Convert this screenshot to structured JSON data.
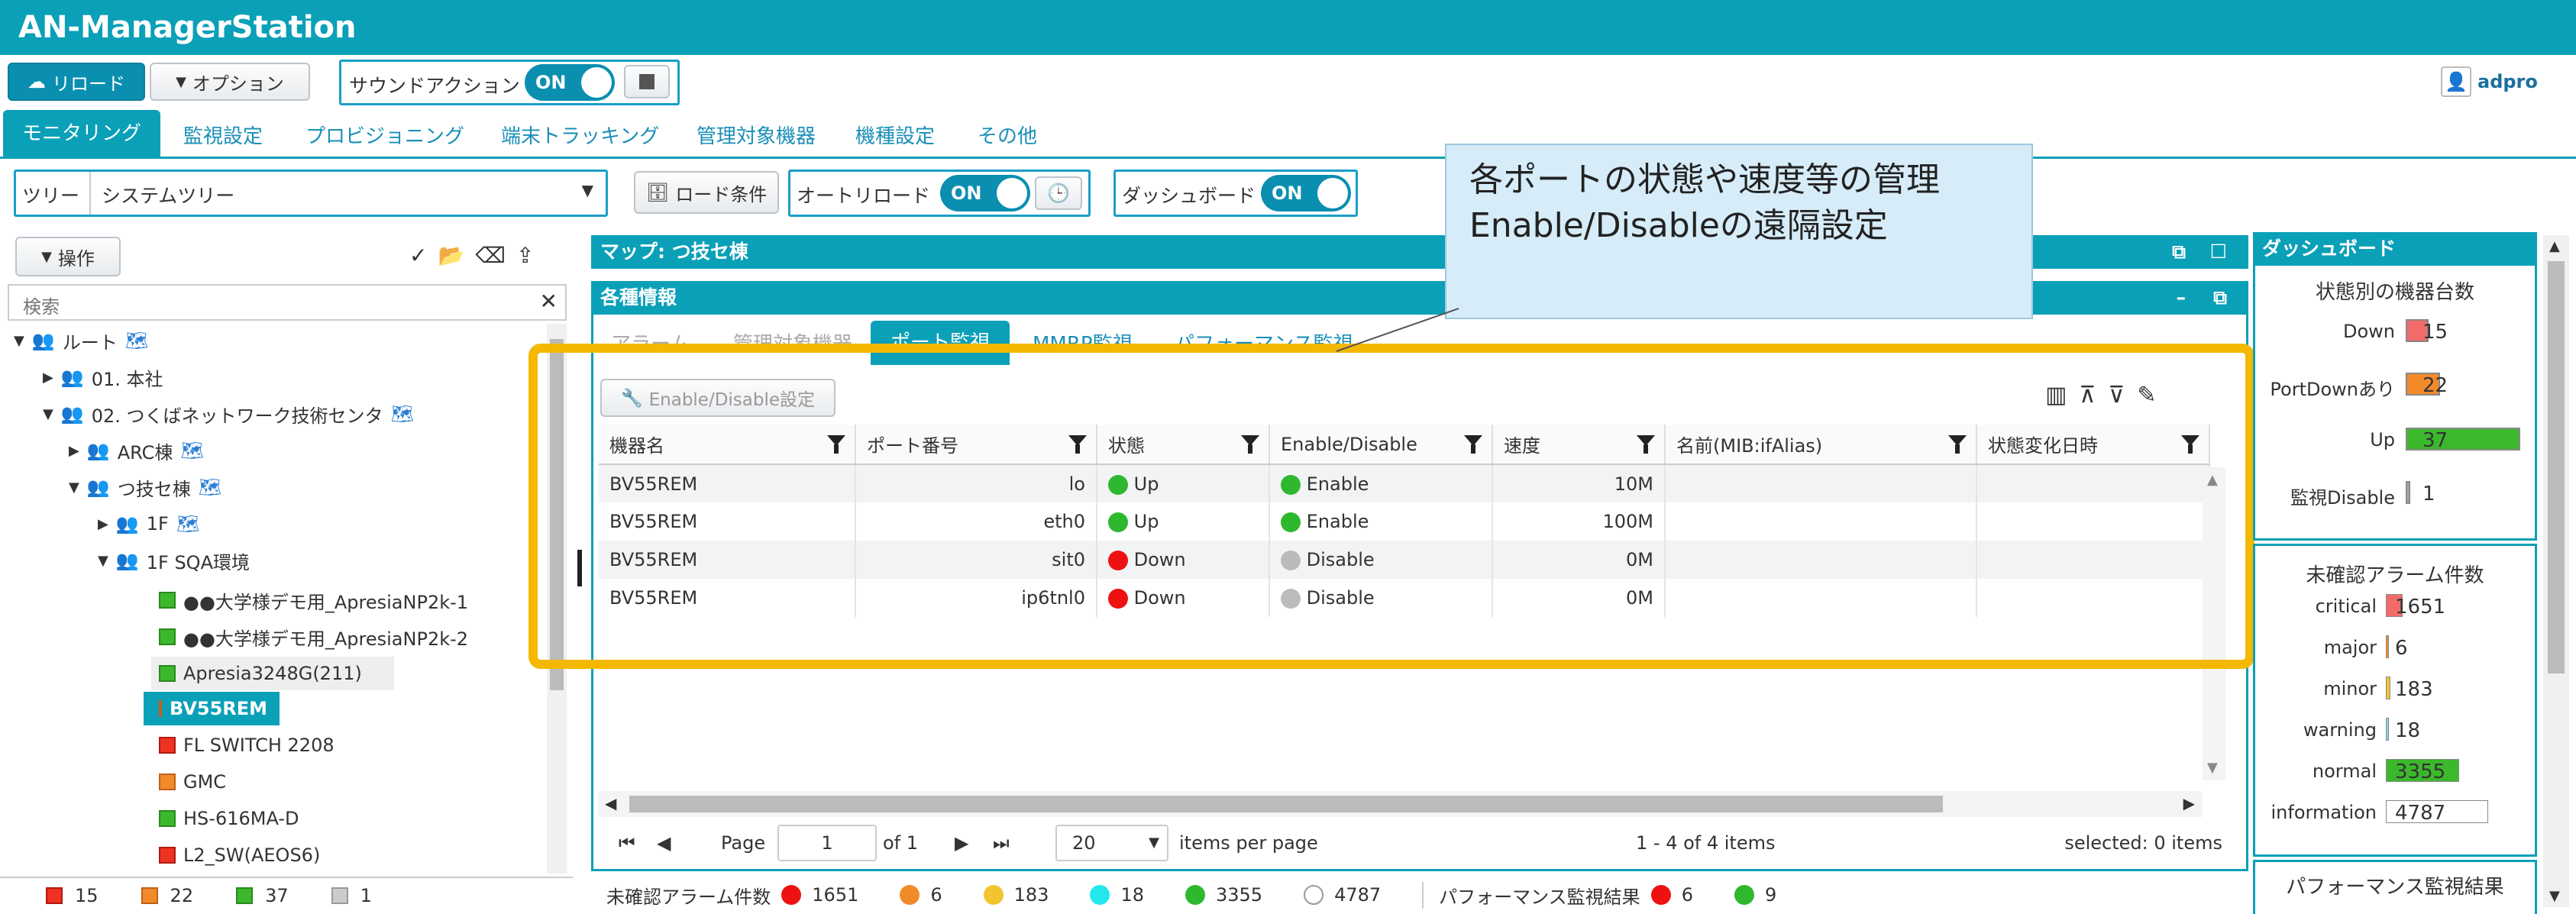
{
  "app": {
    "title": "AN-ManagerStation",
    "user": "adpro"
  },
  "toolbar": {
    "reload": "リロード",
    "options": "オプション",
    "sound_action": "サウンドアクション",
    "sound_toggle": "ON"
  },
  "menu_tabs": [
    "モニタリング",
    "監視設定",
    "プロビジョニング",
    "端末トラッキング",
    "管理対象機器",
    "機種設定",
    "その他"
  ],
  "filterbar": {
    "tree_label": "ツリー",
    "tree_value": "システムツリー",
    "load_condition": "ロード条件",
    "auto_reload": "オートリロード",
    "auto_reload_toggle": "ON",
    "dashboard": "ダッシュボード",
    "dashboard_toggle": "ON"
  },
  "callout": {
    "line1": "各ポートの状態や速度等の管理",
    "line2": "Enable/Disableの遠隔設定"
  },
  "tree": {
    "ops_label": "操作",
    "search_placeholder": "検索",
    "items": [
      {
        "label": "ルート"
      },
      {
        "label": "01. 本社"
      },
      {
        "label": "02. つくばネットワーク技術センタ"
      },
      {
        "label": "ARC棟"
      },
      {
        "label": "つ技セ棟"
      },
      {
        "label": "1F"
      },
      {
        "label": "1F SQA環境"
      },
      {
        "label": "●●大学様デモ用_ApresiaNP2k-1"
      },
      {
        "label": "●●大学様デモ用_ApresiaNP2k-2"
      },
      {
        "label": "Apresia3248G(211)"
      },
      {
        "label": "BV55REM"
      },
      {
        "label": "FL SWITCH 2208"
      },
      {
        "label": "GMC"
      },
      {
        "label": "HS-616MA-D"
      },
      {
        "label": "L2_SW(AEOS6)"
      }
    ],
    "status_counts": [
      "15",
      "22",
      "37",
      "1"
    ]
  },
  "map_panel": {
    "title": "マップ: つ技セ棟"
  },
  "info_panel": {
    "title": "各種情報",
    "tabs": [
      "アラーム",
      "管理対象機器",
      "ポート監視",
      "MMRP監視",
      "パフォーマンス監視"
    ],
    "enable_button": "Enable/Disable設定",
    "columns": [
      "機器名",
      "ポート番号",
      "状態",
      "Enable/Disable",
      "速度",
      "名前(MIB:ifAlias)",
      "状態変化日時"
    ],
    "rows": [
      {
        "device": "BV55REM",
        "port": "lo",
        "state": "Up",
        "enable": "Enable",
        "speed": "10M"
      },
      {
        "device": "BV55REM",
        "port": "eth0",
        "state": "Up",
        "enable": "Enable",
        "speed": "100M"
      },
      {
        "device": "BV55REM",
        "port": "sit0",
        "state": "Down",
        "enable": "Disable",
        "speed": "0M"
      },
      {
        "device": "BV55REM",
        "port": "ip6tnl0",
        "state": "Down",
        "enable": "Disable",
        "speed": "0M"
      }
    ],
    "pager": {
      "page_label": "Page",
      "page_value": "1",
      "of_label": "of 1",
      "per_page": "20",
      "per_page_label": "items per page",
      "range": "1 - 4 of 4 items",
      "selected": "selected: 0 items"
    }
  },
  "statusbar": {
    "alarm_label": "未確認アラーム件数",
    "alarm_counts": [
      "1651",
      "6",
      "183",
      "18",
      "3355",
      "4787"
    ],
    "perf_label": "パフォーマンス監視結果",
    "perf_counts": [
      "6",
      "9"
    ]
  },
  "dashboard": {
    "title": "ダッシュボード",
    "device_section": "状態別の機器台数",
    "device_stats": [
      {
        "label": "Down",
        "value": "15",
        "fraction": 0.2
      },
      {
        "label": "PortDownあり",
        "value": "22",
        "fraction": 0.3
      },
      {
        "label": "Up",
        "value": "37",
        "fraction": 1.0
      },
      {
        "label": "監視Disable",
        "value": "1",
        "fraction": 0.02
      }
    ],
    "alarm_section": "未確認アラーム件数",
    "alarm_stats": [
      {
        "label": "critical",
        "value": "1651"
      },
      {
        "label": "major",
        "value": "6"
      },
      {
        "label": "minor",
        "value": "183"
      },
      {
        "label": "warning",
        "value": "18"
      },
      {
        "label": "normal",
        "value": "3355"
      },
      {
        "label": "information",
        "value": "4787"
      }
    ],
    "perf_section": "パフォーマンス監視結果"
  }
}
